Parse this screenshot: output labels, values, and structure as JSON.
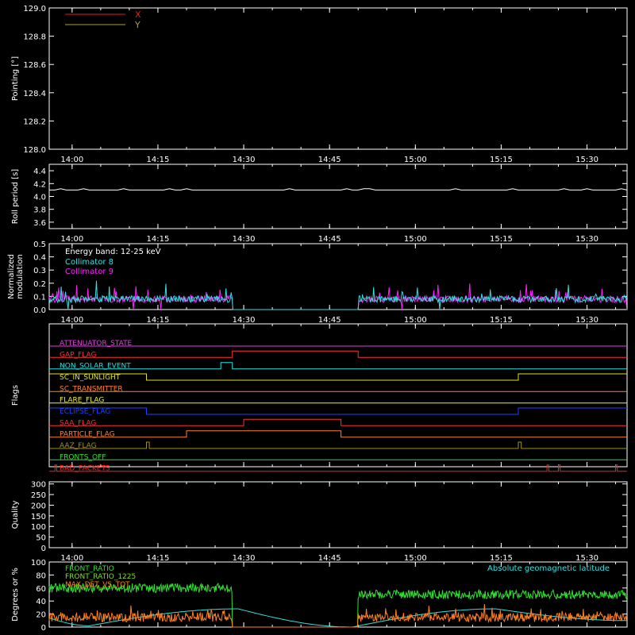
{
  "time_axis": {
    "start": "13:56",
    "end": "15:37",
    "ticks": [
      "14:00",
      "14:15",
      "14:30",
      "14:45",
      "15:00",
      "15:15",
      "15:30"
    ]
  },
  "chart_data": [
    {
      "id": "pointing",
      "type": "line",
      "ylabel": "Pointing [°]",
      "ylim": [
        128.0,
        129.0
      ],
      "yticks": [
        "128.0",
        "128.2",
        "128.4",
        "128.6",
        "128.8",
        "129.0"
      ],
      "legend": [
        {
          "name": "X",
          "color": "#e02020"
        },
        {
          "name": "Y",
          "color": "#b0a030"
        }
      ],
      "series": []
    },
    {
      "id": "roll",
      "type": "line",
      "ylabel": "Roll period [s]",
      "ylim": [
        3.5,
        4.5
      ],
      "yticks": [
        "3.6",
        "3.8",
        "4.0",
        "4.2",
        "4.4"
      ],
      "series": [
        {
          "name": "Roll period",
          "color": "#ffffff",
          "value": 4.1
        }
      ]
    },
    {
      "id": "modulation",
      "type": "line",
      "ylabel": "Normalized modulation",
      "ylim": [
        0,
        0.5
      ],
      "yticks": [
        "0.0",
        "0.1",
        "0.2",
        "0.3",
        "0.4",
        "0.5"
      ],
      "annotation": "Energy band: 12-25 keV",
      "legend": [
        {
          "name": "Collimator 8",
          "color": "#30e0e0"
        },
        {
          "name": "Collimator 9",
          "color": "#ff20ff"
        }
      ],
      "gaps": [
        [
          "14:28",
          "14:50"
        ]
      ],
      "base_level": 0.08
    },
    {
      "id": "flags",
      "type": "line",
      "ylabel": "Flags",
      "rows": [
        {
          "label": "ATTENUATOR_STATE",
          "color": "#e040e0",
          "on": []
        },
        {
          "label": "GAP_FLAG",
          "color": "#ff3030",
          "on": [
            [
              "14:28",
              "14:50"
            ]
          ]
        },
        {
          "label": "NON_SOLAR_EVENT",
          "color": "#20e0e0",
          "on": [
            [
              "14:26",
              "14:28"
            ]
          ]
        },
        {
          "label": "SC_IN_SUNLIGHT",
          "color": "#e0e020",
          "on": [
            [
              "13:56",
              "14:13"
            ],
            [
              "15:18",
              "15:37"
            ]
          ]
        },
        {
          "label": "SC_TRANSMITTER",
          "color": "#ff8030",
          "on": []
        },
        {
          "label": "FLARE_FLAG",
          "color": "#f0f030",
          "on": []
        },
        {
          "label": "ECLIPSE_FLAG",
          "color": "#2040ff",
          "on": [
            [
              "13:56",
              "14:13"
            ],
            [
              "15:18",
              "15:37"
            ]
          ]
        },
        {
          "label": "SAA_FLAG",
          "color": "#ff3030",
          "on": [
            [
              "14:30",
              "14:47"
            ]
          ]
        },
        {
          "label": "PARTICLE_FLAG",
          "color": "#ff8030",
          "on": [
            [
              "14:20",
              "14:47"
            ]
          ]
        },
        {
          "label": "AAZ_FLAG",
          "color": "#a09020",
          "on": [
            [
              "14:13",
              "14:13.5"
            ],
            [
              "15:18",
              "15:18.5"
            ]
          ]
        },
        {
          "label": "FRONTS_OFF",
          "color": "#30e030",
          "on": []
        },
        {
          "label": "BAD_PACKETS",
          "color": "#ff2020",
          "on": [
            [
              "13:57",
              "13:57.3"
            ],
            [
              "15:23",
              "15:23.3"
            ],
            [
              "15:25",
              "15:25.3"
            ],
            [
              "15:35",
              "15:35.3"
            ]
          ]
        }
      ]
    },
    {
      "id": "quality",
      "type": "line",
      "ylabel": "Quality",
      "ylim": [
        0,
        310
      ],
      "yticks": [
        "0",
        "50",
        "100",
        "150",
        "200",
        "250",
        "300"
      ],
      "series": [
        {
          "name": "Quality",
          "color": "#ffffff",
          "value": 0
        }
      ]
    },
    {
      "id": "ratios",
      "type": "line",
      "ylabel": "Degrees or %",
      "ylim": [
        0,
        100
      ],
      "yticks": [
        "0",
        "20",
        "40",
        "60",
        "80",
        "100"
      ],
      "legend": [
        {
          "name": "FRONT_RATIO",
          "color": "#30e030"
        },
        {
          "name": "FRONT_RATIO_1225",
          "color": "#80e020"
        },
        {
          "name": "MAX_DET_VS_TOT",
          "color": "#ff8020"
        }
      ],
      "legend_right": {
        "name": "Absolute geomagnetic latitude",
        "color": "#30e0e0"
      },
      "gaps": [
        [
          "14:28",
          "14:50"
        ]
      ],
      "front_ratio_level": 60,
      "front_ratio_after": 50,
      "max_det_level": 15,
      "latitude": [
        [
          "13:56",
          14
        ],
        [
          "14:03",
          2
        ],
        [
          "14:29",
          28
        ],
        [
          "14:49",
          0
        ],
        [
          "15:14",
          28
        ],
        [
          "15:37",
          10
        ]
      ]
    }
  ]
}
